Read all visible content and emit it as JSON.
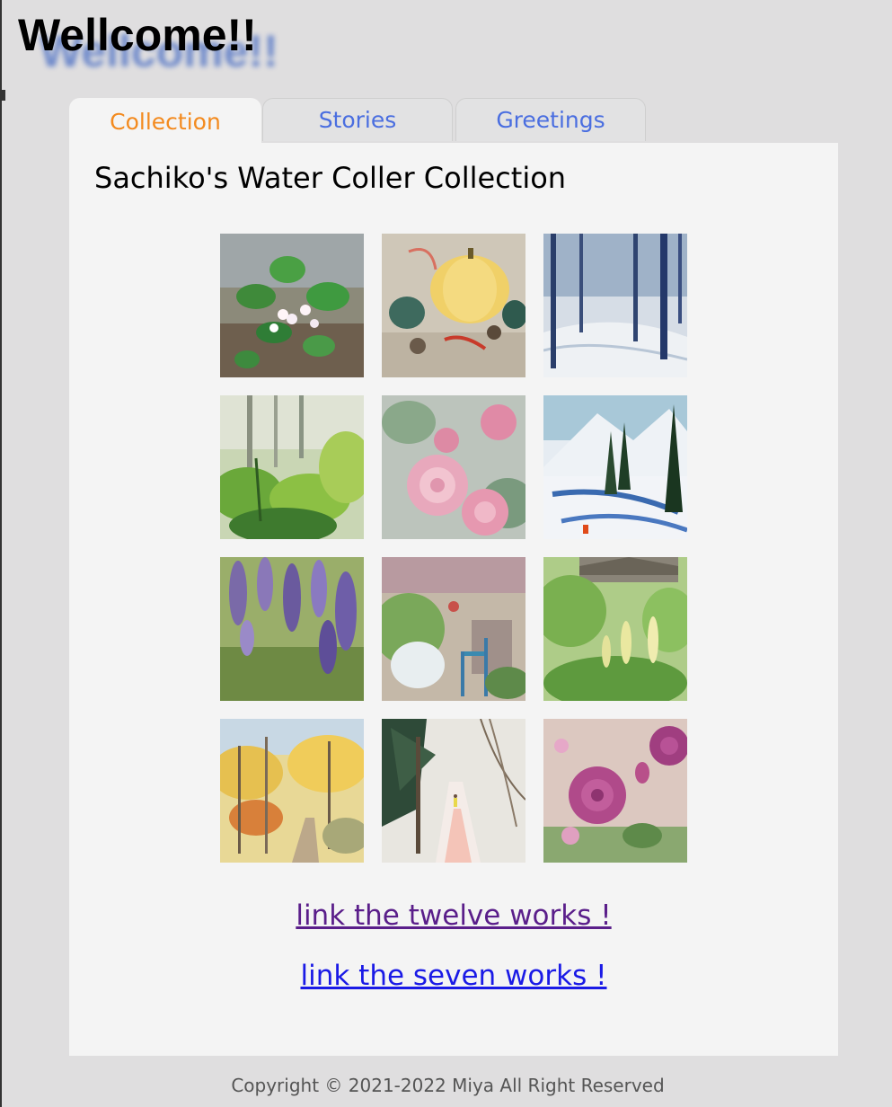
{
  "page": {
    "heading": "Wellcome!!"
  },
  "tabs": [
    {
      "label": "Collection",
      "active": true
    },
    {
      "label": "Stories",
      "active": false
    },
    {
      "label": "Greetings",
      "active": false
    }
  ],
  "panel": {
    "title": "Sachiko's Water Coller Collection"
  },
  "links": {
    "twelve": "link the twelve works !",
    "seven": "link the seven works !"
  },
  "footer": {
    "copyright": "Copyright © 2021-2022 Miya All Right Reserved"
  },
  "colors": {
    "tab_active": "#f38a1e",
    "tab_inactive": "#4a6ee0",
    "link_visited": "#5a1e8a",
    "link_new": "#1a1ae6"
  }
}
